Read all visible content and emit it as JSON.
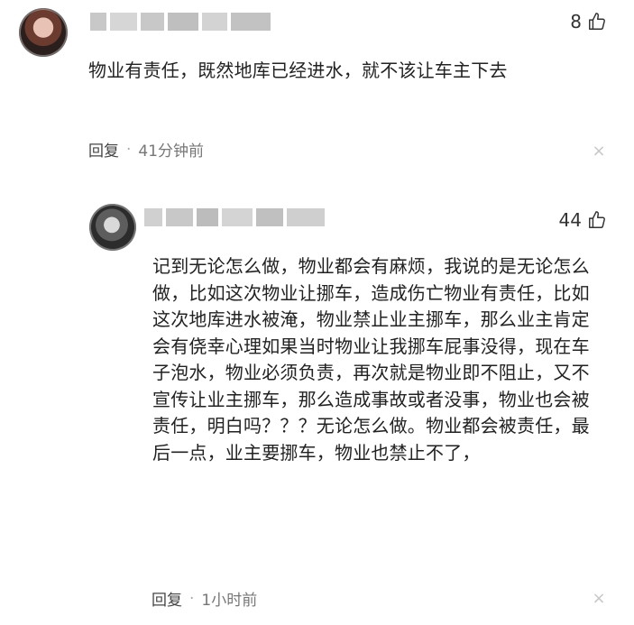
{
  "comments": [
    {
      "likes": "8",
      "text": "物业有责任，既然地库已经进水，就不该让车主下去",
      "reply_label": "回复",
      "time": "41分钟前"
    },
    {
      "likes": "44",
      "text": "记到无论怎么做，物业都会有麻烦，我说的是无论怎么做，比如这次物业让挪车，造成伤亡物业有责任，比如这次地库进水被淹，物业禁止业主挪车，那么业主肯定会有侥幸心理如果当时物业让我挪车屁事没得，现在车子泡水，物业必须负责，再次就是物业即不阻止，又不宣传让业主挪车，那么造成事故或者没事，物业也会被责任，明白吗？？？无论怎么做。物业都会被责任，最后一点，业主要挪车，物业也禁止不了，",
      "reply_label": "回复",
      "time": "1小时前"
    }
  ],
  "icons": {
    "like": "thumbs-up-icon",
    "close": "close-icon"
  },
  "colors": {
    "text": "#222222",
    "meta": "#777777",
    "redaction": "#c8c8c8"
  }
}
